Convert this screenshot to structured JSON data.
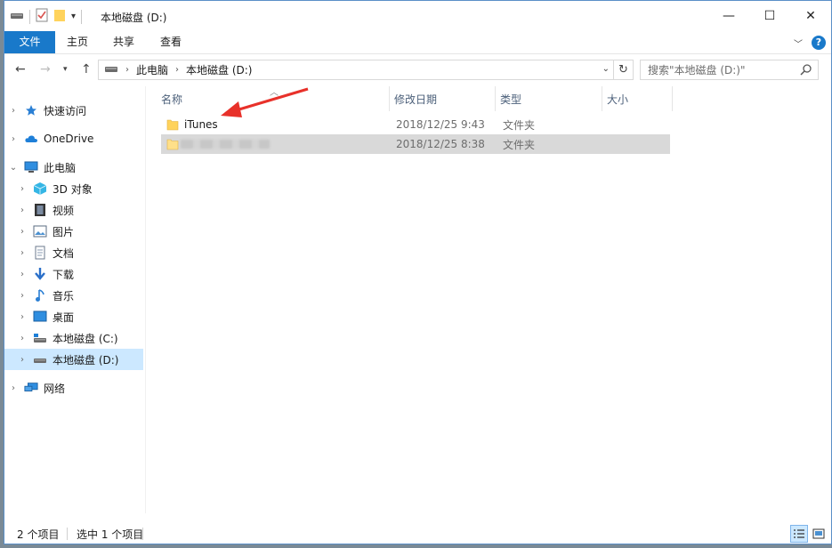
{
  "window": {
    "title": "本地磁盘 (D:)",
    "controls": {
      "minimize": "—",
      "maximize": "☐",
      "close": "✕"
    }
  },
  "ribbon": {
    "tabs": [
      "文件",
      "主页",
      "共享",
      "查看"
    ]
  },
  "nav": {
    "breadcrumbs": [
      "此电脑",
      "本地磁盘 (D:)"
    ],
    "search_placeholder": "搜索\"本地磁盘 (D:)\""
  },
  "sidebar": {
    "items": [
      {
        "label": "快速访问",
        "icon": "star-icon"
      },
      {
        "label": "OneDrive",
        "icon": "cloud-icon"
      },
      {
        "label": "此电脑",
        "icon": "computer-icon"
      },
      {
        "label": "3D 对象",
        "icon": "cube-icon"
      },
      {
        "label": "视频",
        "icon": "film-icon"
      },
      {
        "label": "图片",
        "icon": "picture-icon"
      },
      {
        "label": "文档",
        "icon": "document-icon"
      },
      {
        "label": "下载",
        "icon": "download-icon"
      },
      {
        "label": "音乐",
        "icon": "music-icon"
      },
      {
        "label": "桌面",
        "icon": "desktop-icon"
      },
      {
        "label": "本地磁盘 (C:)",
        "icon": "drive-c-icon"
      },
      {
        "label": "本地磁盘 (D:)",
        "icon": "drive-d-icon"
      },
      {
        "label": "网络",
        "icon": "network-icon"
      }
    ]
  },
  "table": {
    "columns": [
      "名称",
      "修改日期",
      "类型",
      "大小"
    ],
    "rows": [
      {
        "name": "iTunes",
        "date": "2018/12/25 9:43",
        "type": "文件夹"
      },
      {
        "name": "",
        "date": "2018/12/25 8:38",
        "type": "文件夹"
      }
    ]
  },
  "status": {
    "item_count": "2 个项目",
    "selected": "选中 1 个项目"
  },
  "colors": {
    "accent": "#1979ca",
    "selection": "#cce8ff",
    "annotation_arrow": "#e8312a"
  }
}
